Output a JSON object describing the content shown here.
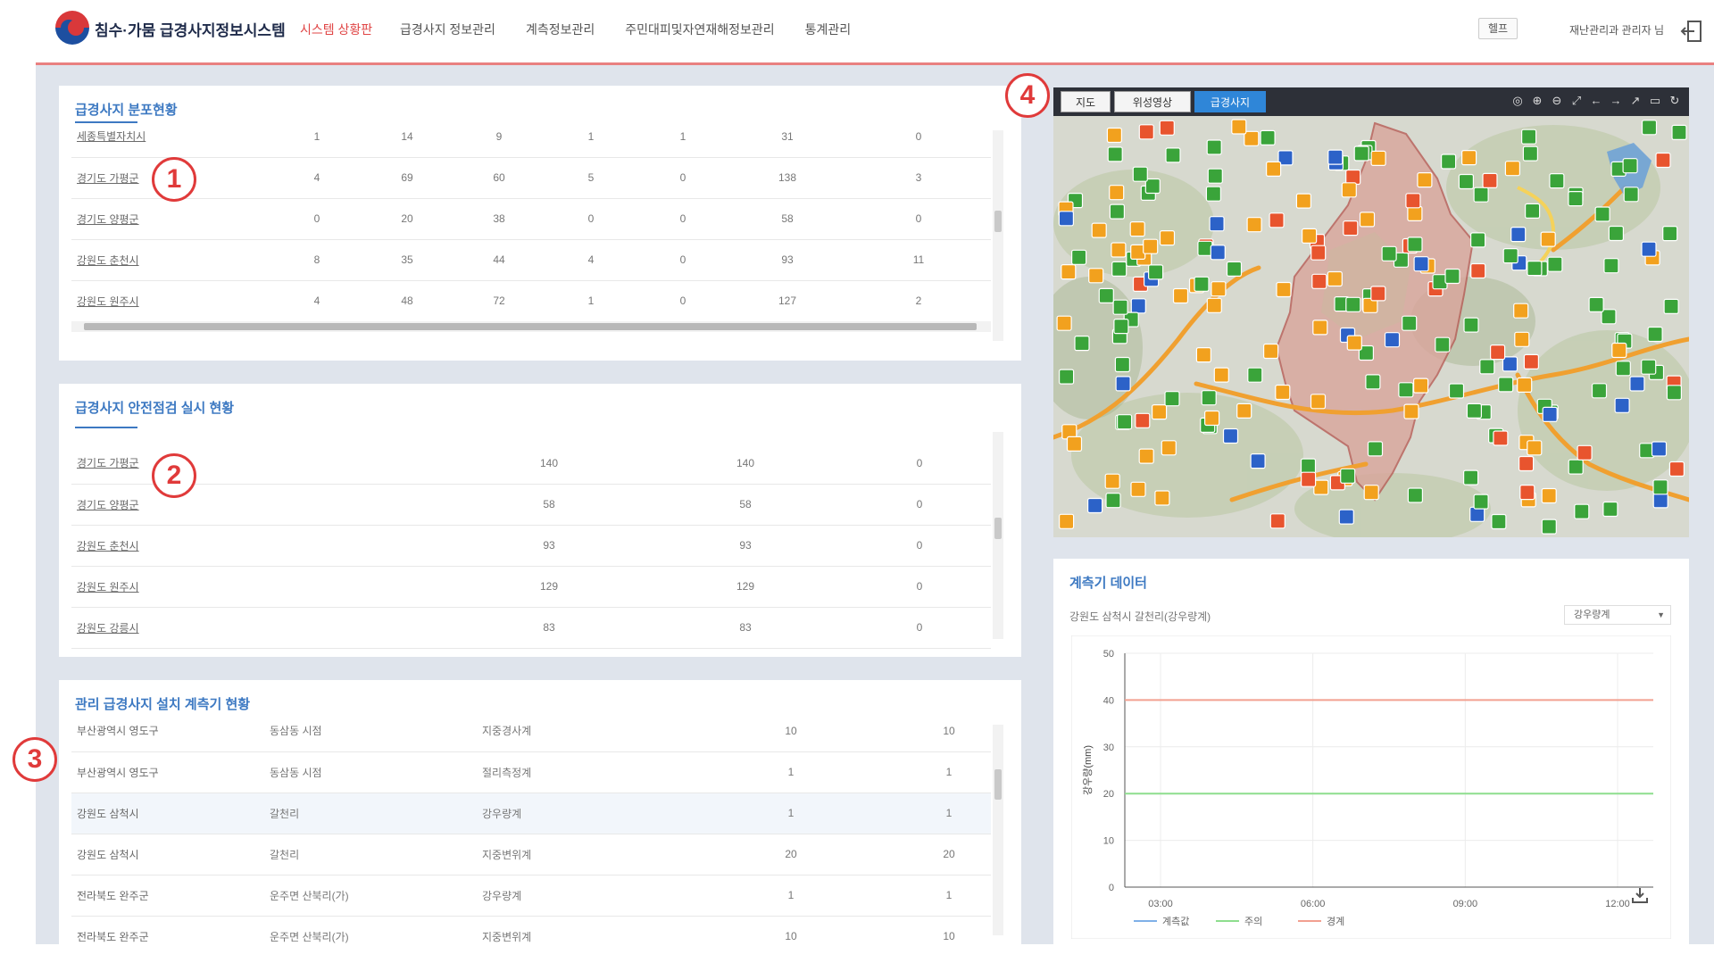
{
  "header": {
    "title": "침수·가뭄 급경사지정보시스템",
    "subtitle": "시스템 상황판",
    "nav": [
      "급경사지 정보관리",
      "계측정보관리",
      "주민대피및자연재해정보관리",
      "통계관리"
    ],
    "help_button": "헬프",
    "user_label": "재난관리과 관리자 님"
  },
  "badges": [
    "1",
    "2",
    "3",
    "4"
  ],
  "panel1": {
    "title": "급경사지 분포현황",
    "rows": [
      [
        "세종특별자치시",
        "1",
        "14",
        "9",
        "1",
        "1",
        "31",
        "0"
      ],
      [
        "경기도 가평군",
        "4",
        "69",
        "60",
        "5",
        "0",
        "138",
        "3"
      ],
      [
        "경기도 양평군",
        "0",
        "20",
        "38",
        "0",
        "0",
        "58",
        "0"
      ],
      [
        "강원도 춘천시",
        "8",
        "35",
        "44",
        "4",
        "0",
        "93",
        "11"
      ],
      [
        "강원도 원주시",
        "4",
        "48",
        "72",
        "1",
        "0",
        "127",
        "2"
      ]
    ]
  },
  "panel2": {
    "title": "급경사지 안전점검 실시 현황",
    "rows": [
      [
        "경기도 가평군",
        "140",
        "140",
        "0"
      ],
      [
        "경기도 양평군",
        "58",
        "58",
        "0"
      ],
      [
        "강원도 춘천시",
        "93",
        "93",
        "0"
      ],
      [
        "강원도 원주시",
        "129",
        "129",
        "0"
      ],
      [
        "강원도 강릉시",
        "83",
        "83",
        "0"
      ]
    ]
  },
  "panel3": {
    "title": "관리 급경사지 설치 계측기 현황",
    "rows": [
      [
        "부산광역시 영도구",
        "동삼동 시점",
        "지중경사계",
        "10",
        "10"
      ],
      [
        "부산광역시 영도구",
        "동삼동 시점",
        "절리측정계",
        "1",
        "1"
      ],
      [
        "강원도 삼척시",
        "갈천리",
        "강우량계",
        "1",
        "1"
      ],
      [
        "강원도 삼척시",
        "갈천리",
        "지중변위계",
        "20",
        "20"
      ],
      [
        "전라북도 완주군",
        "운주면 산북리(가)",
        "강우량계",
        "1",
        "1"
      ],
      [
        "전라북도 완주군",
        "운주면 산북리(가)",
        "지중변위계",
        "10",
        "10"
      ]
    ]
  },
  "map": {
    "tabs": [
      "지도",
      "위성영상",
      "급경사지"
    ],
    "active_tab": "급경사지",
    "tool_icons": [
      "locate-icon",
      "zoom-in-icon",
      "zoom-out-icon",
      "extent-icon",
      "prev-icon",
      "next-icon",
      "measure-icon",
      "area-icon",
      "refresh-icon"
    ]
  },
  "chart_panel": {
    "title": "계측기 데이터",
    "subtitle": "강원도 삼척시 갈천리(강우량계)",
    "select_value": "강우량계"
  },
  "chart_data": {
    "type": "line",
    "ylabel": "강우량(mm)",
    "x_ticks": [
      "03:00",
      "06:00",
      "09:00",
      "12:00"
    ],
    "ylim": [
      0,
      50
    ],
    "y_ticks": [
      0,
      10,
      20,
      30,
      40,
      50
    ],
    "series": [
      {
        "name": "계측값",
        "color": "#7fb0e8",
        "values": []
      },
      {
        "name": "주의",
        "color": "#8ede8e",
        "values": [
          20,
          20
        ]
      },
      {
        "name": "경계",
        "color": "#f2a090",
        "values": [
          40,
          40
        ]
      }
    ],
    "legend_position": "bottom-left",
    "grid": true
  }
}
